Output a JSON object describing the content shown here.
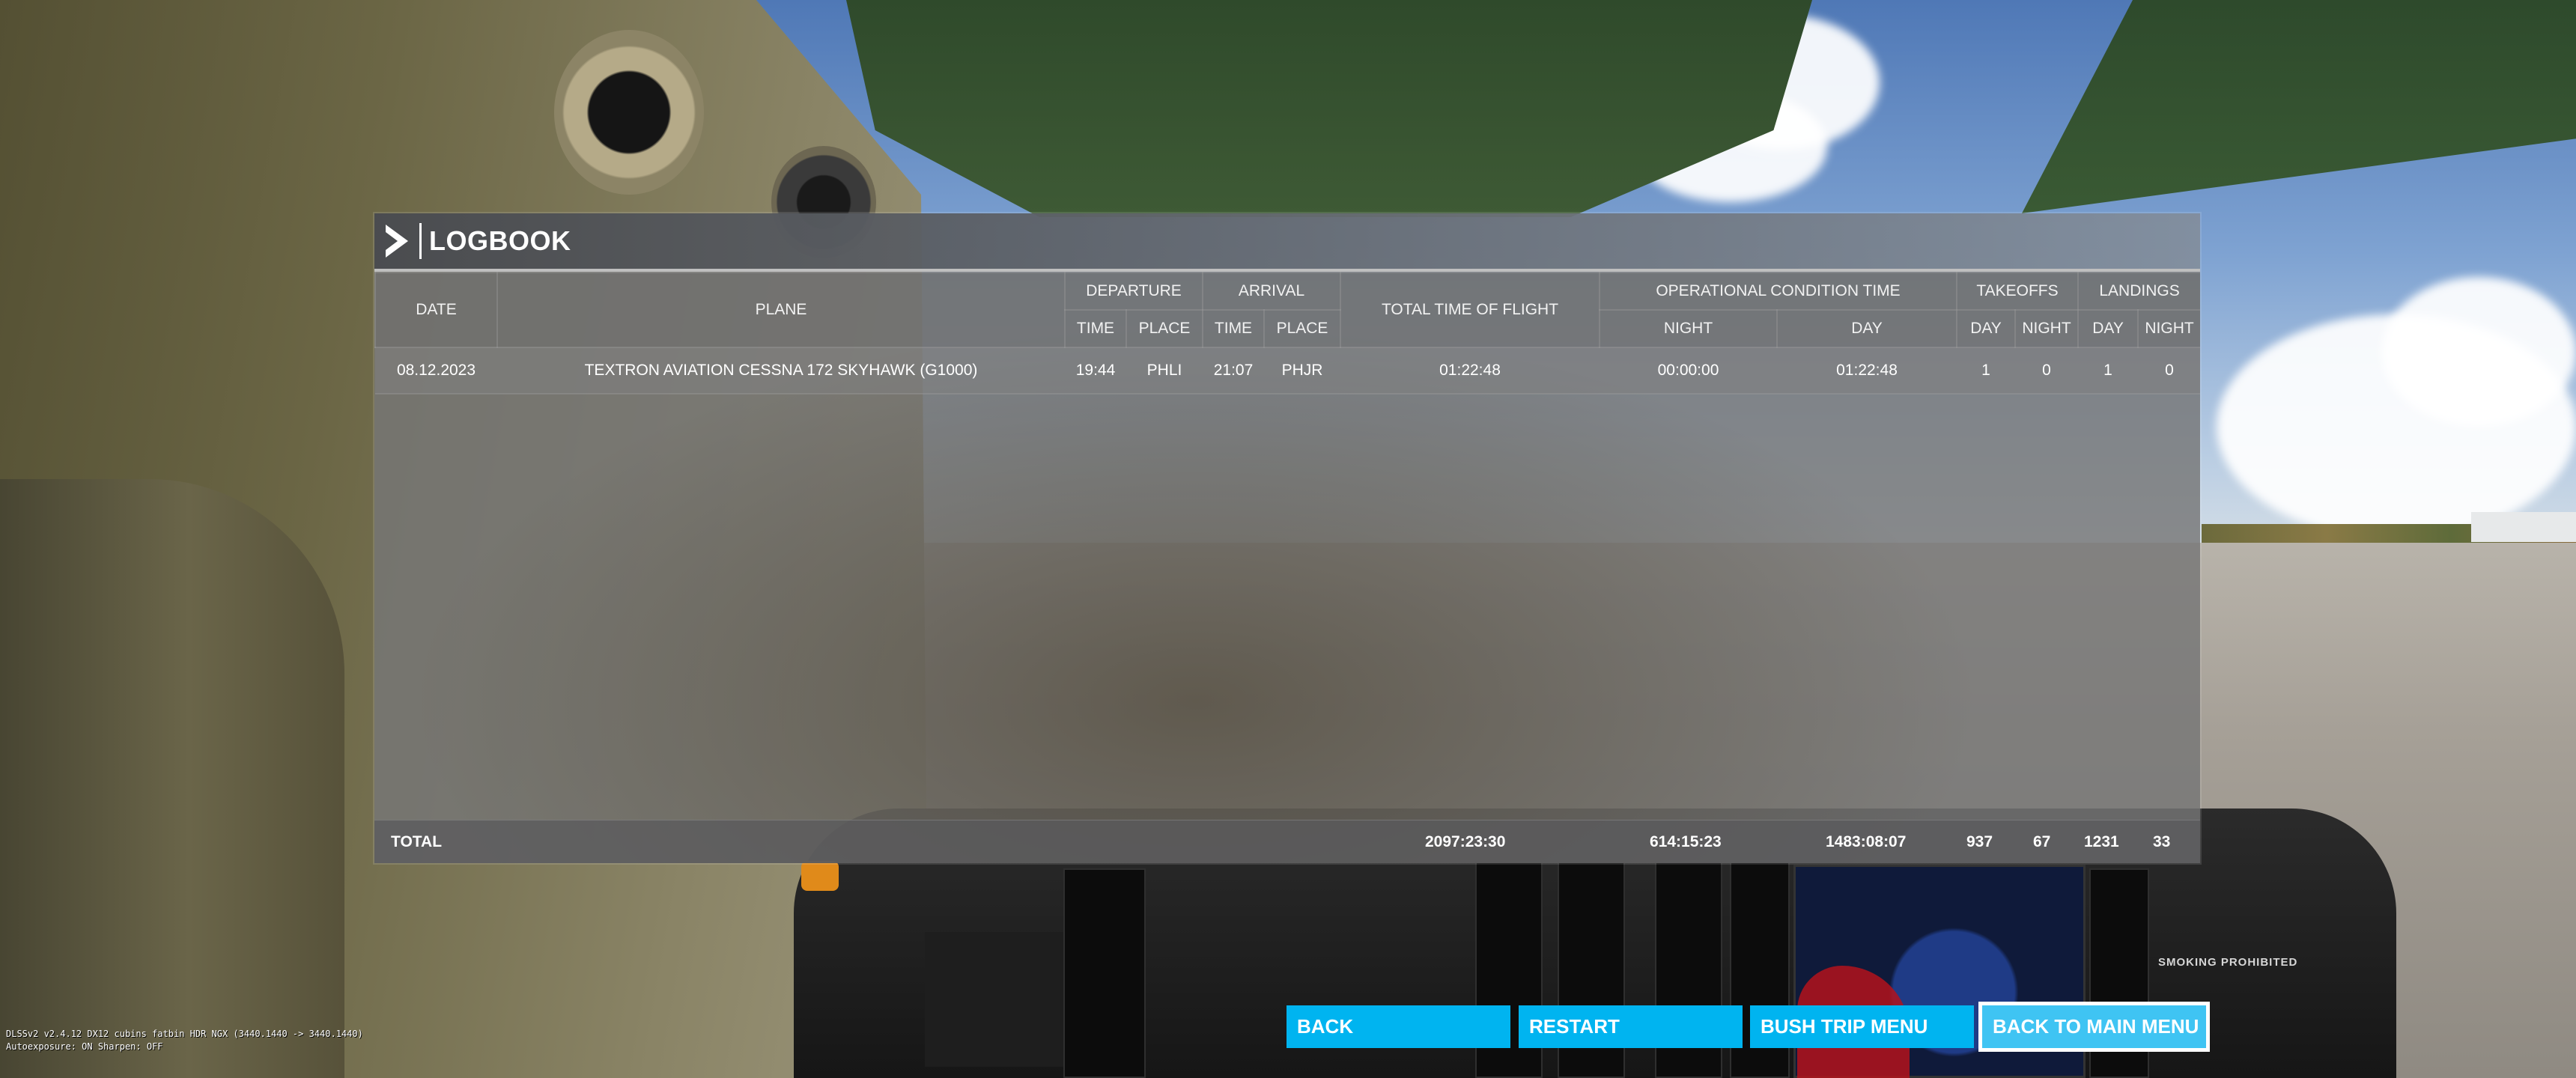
{
  "logbook": {
    "title": "LOGBOOK",
    "headers": {
      "date": "DATE",
      "plane": "PLANE",
      "departure": "DEPARTURE",
      "arrival": "ARRIVAL",
      "total_time_of_flight": "TOTAL TIME OF FLIGHT",
      "operational_condition_time": "OPERATIONAL CONDITION TIME",
      "takeoffs": "TAKEOFFS",
      "landings": "LANDINGS",
      "time": "TIME",
      "place": "PLACE",
      "night": "NIGHT",
      "day": "DAY"
    },
    "rows": [
      {
        "date": "08.12.2023",
        "plane": "TEXTRON AVIATION CESSNA 172 SKYHAWK (G1000)",
        "departure_time": "19:44",
        "departure_place": "PHLI",
        "arrival_time": "21:07",
        "arrival_place": "PHJR",
        "total_time": "01:22:48",
        "op_night": "00:00:00",
        "op_day": "01:22:48",
        "takeoffs_day": "1",
        "takeoffs_night": "0",
        "landings_day": "1",
        "landings_night": "0"
      }
    ],
    "totals": {
      "label": "TOTAL",
      "total_time": "2097:23:30",
      "op_night": "614:15:23",
      "op_day": "1483:08:07",
      "takeoffs_day": "937",
      "takeoffs_night": "67",
      "landings_day": "1231",
      "landings_night": "33"
    }
  },
  "buttons": {
    "back": "BACK",
    "restart": "RESTART",
    "bush_trip_menu": "BUSH TRIP MENU",
    "back_to_main_menu": "BACK TO MAIN MENU"
  },
  "scene": {
    "placard": "SMOKING PROHIBITED"
  },
  "overlay": {
    "line1": "DLSSv2 v2.4.12 DX12 cubins fatbin HDR NGX (3440.1440 -> 3440.1440)",
    "line2": "Autoexposure: ON Sharpen: OFF"
  },
  "colors": {
    "button_bg": "#00b4f0",
    "button_active_border": "#ffffff",
    "panel_bg": "#767676"
  }
}
